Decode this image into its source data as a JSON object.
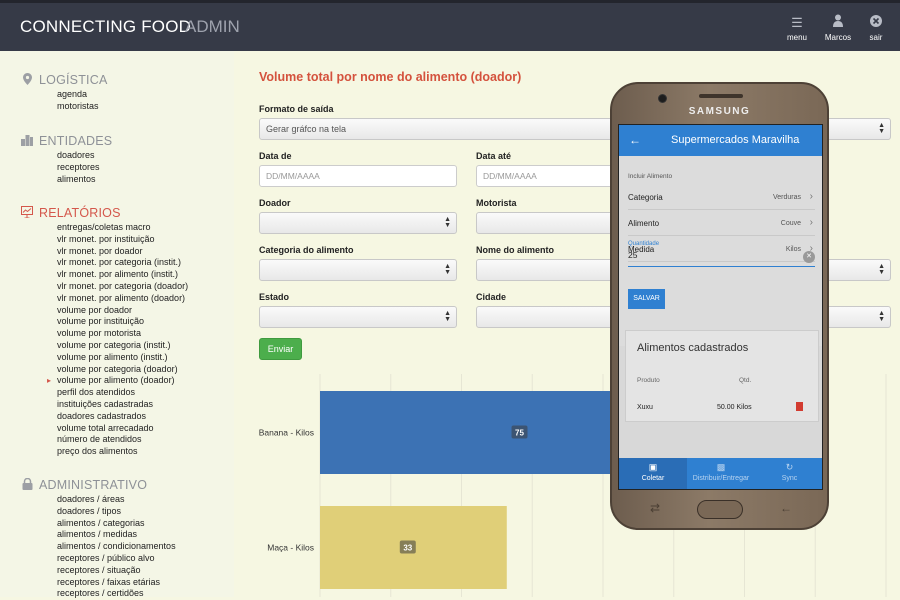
{
  "header": {
    "brand": "CONNECTING FOOD",
    "section": "ADMIN",
    "actions": [
      {
        "label": "menu",
        "icon": "menu-icon"
      },
      {
        "label": "Marcos",
        "icon": "user-icon"
      },
      {
        "label": "sair",
        "icon": "close-circle-icon"
      }
    ]
  },
  "sidebar": {
    "logistica": {
      "title": "LOGÍSTICA",
      "icon": "map-pin-icon",
      "items": [
        "agenda",
        "motoristas"
      ]
    },
    "entidades": {
      "title": "ENTIDADES",
      "icon": "building-icon",
      "items": [
        "doadores",
        "receptores",
        "alimentos"
      ]
    },
    "relatorios": {
      "title": "RELATÓRIOS",
      "icon": "chart-icon",
      "active_item": "volume por alimento (doador)",
      "items": [
        "entregas/coletas macro",
        "vlr monet. por instituição",
        "vlr monet. por doador",
        "vlr monet. por categoria (instit.)",
        "vlr monet. por alimento (instit.)",
        "vlr monet. por categoria (doador)",
        "vlr monet. por alimento (doador)",
        "volume por doador",
        "volume por instituição",
        "volume por motorista",
        "volume por categoria (instit.)",
        "volume por alimento (instit.)",
        "volume por categoria (doador)",
        "volume por alimento (doador)",
        "perfil dos atendidos",
        "instituições cadastradas",
        "doadores cadastrados",
        "volume total arrecadado",
        "número de atendidos",
        "preço dos alimentos"
      ]
    },
    "administrativo": {
      "title": "ADMINISTRATIVO",
      "icon": "lock-icon",
      "items": [
        "doadores / áreas",
        "doadores / tipos",
        "alimentos / categorias",
        "alimentos / medidas",
        "alimentos / condicionamentos",
        "receptores / público alvo",
        "receptores / situação",
        "receptores / faixas etárias",
        "receptores / certidões"
      ]
    }
  },
  "form": {
    "title": "Volume total por nome do alimento (doador)",
    "formato_label": "Formato de saída",
    "formato_value": "Gerar gráfco na tela",
    "data_de_label": "Data de",
    "data_de_placeholder": "DD/MM/AAAA",
    "data_ate_label": "Data até",
    "data_ate_placeholder": "DD/MM/AAAA",
    "doador_label": "Doador",
    "motorista_label": "Motorista",
    "categoria_label": "Categoria do alimento",
    "nome_label": "Nome do alimento",
    "estado_label": "Estado",
    "cidade_label": "Cidade",
    "submit": "Enviar"
  },
  "chart_data": {
    "type": "bar",
    "orientation": "horizontal",
    "categories": [
      "Banana - Kilos",
      "Maça - Kilos"
    ],
    "values": [
      75,
      33
    ],
    "colors": [
      "#3c72b4",
      "#e0cf78"
    ]
  },
  "phone": {
    "brand": "SAMSUNG",
    "app_title": "Supermercados Maravilha",
    "subtitle": "Incluir Alimento",
    "rows": [
      {
        "label": "Categoria",
        "value": "Verduras"
      },
      {
        "label": "Alimento",
        "value": "Couve"
      },
      {
        "label": "Medida",
        "value": "Kilos"
      }
    ],
    "quantity_label": "Quantidade",
    "quantity_value": "25",
    "save": "SALVAR",
    "card_title": "Alimentos cadastrados",
    "col_produto": "Produto",
    "col_qtd": "Qtd.",
    "item_produto": "Xuxu",
    "item_qtd": "50.00 Kilos",
    "tabs": [
      {
        "label": "Coletar",
        "icon": "store-icon"
      },
      {
        "label": "Distribuir/Entregar",
        "icon": "truck-icon"
      },
      {
        "label": "Sync",
        "icon": "sync-icon"
      }
    ]
  }
}
